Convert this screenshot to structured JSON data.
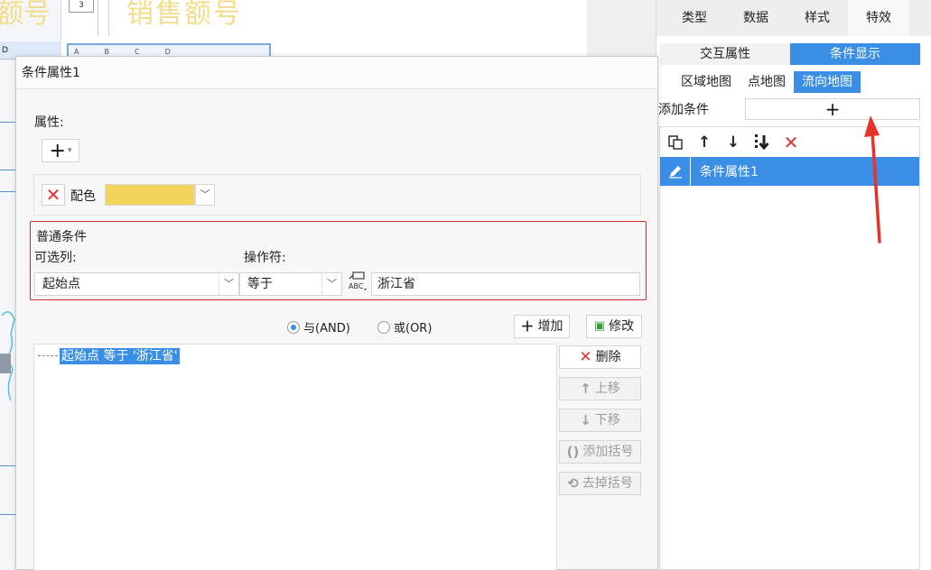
{
  "background": {
    "title_left": "额号",
    "title_right": "销售额号",
    "cell_number": "3",
    "row_header": "D",
    "mini_cols": [
      "A",
      "B",
      "C",
      "D"
    ]
  },
  "right_panel": {
    "tabs": [
      {
        "label": "类型",
        "active": false
      },
      {
        "label": "数据",
        "active": false
      },
      {
        "label": "样式",
        "active": false
      },
      {
        "label": "特效",
        "active": true
      }
    ],
    "subtabs": [
      {
        "label": "交互属性",
        "active": false
      },
      {
        "label": "条件显示",
        "active": true
      }
    ],
    "map_tabs": [
      {
        "label": "区域地图",
        "active": false
      },
      {
        "label": "点地图",
        "active": false
      },
      {
        "label": "流向地图",
        "active": true
      }
    ],
    "add_condition_label": "添加条件",
    "add_button": "+",
    "toolbar_icons": [
      "copy-icon",
      "arrow-up-icon",
      "arrow-down-icon",
      "move-to-bottom-icon",
      "delete-icon"
    ],
    "items": [
      {
        "label": "条件属性1",
        "icon": "edit-icon",
        "selected": true
      }
    ]
  },
  "dialog": {
    "title": "条件属性1",
    "properties_label": "属性:",
    "add_property_button": "+",
    "property_row": {
      "label": "配色",
      "color": "#f4d35a"
    },
    "condition_box": {
      "title": "普通条件",
      "column_label": "可选列:",
      "column_value": "起始点",
      "operator_label": "操作符:",
      "operator_value": "等于",
      "value": "浙江省"
    },
    "logic": {
      "and_label": "与(AND)",
      "or_label": "或(OR)",
      "selected": "and"
    },
    "buttons": {
      "add": "增加",
      "modify": "修改",
      "delete": "删除",
      "move_up": "上移",
      "move_down": "下移",
      "add_bracket": "添加括号",
      "remove_bracket": "去掉括号"
    },
    "conditions": [
      "起始点 等于 '浙江省'"
    ]
  },
  "colors": {
    "accent": "#3a8ee6",
    "danger": "#e5322d",
    "highlight_border": "#d03030"
  }
}
